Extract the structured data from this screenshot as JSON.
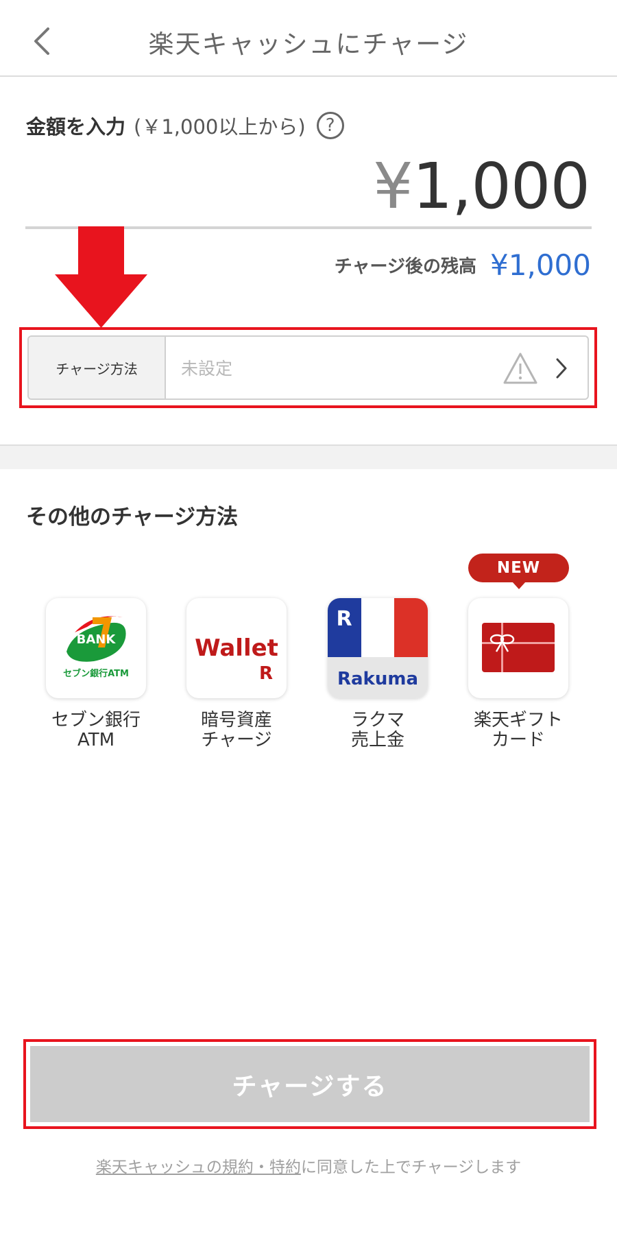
{
  "header": {
    "title": "楽天キャッシュにチャージ"
  },
  "amount": {
    "label": "金額を入力",
    "min_note": "(￥1,000以上から)",
    "help_symbol": "?",
    "currency_symbol": "¥",
    "value": "1,000"
  },
  "balance": {
    "label": "チャージ後の残高",
    "value": "¥1,000"
  },
  "method": {
    "label": "チャージ方法",
    "value": "未設定"
  },
  "other_methods": {
    "title": "その他のチャージ方法",
    "new_badge": "NEW",
    "items": [
      {
        "label": "セブン銀行\nATM",
        "icon": "seven-bank-icon",
        "icon_text_top": "BANK",
        "icon_text_bottom": "セブン銀行ATM"
      },
      {
        "label": "暗号資産\nチャージ",
        "icon": "rakuten-wallet-icon",
        "icon_text_top": "Wallet",
        "icon_text_bottom": "R"
      },
      {
        "label": "ラクマ\n売上金",
        "icon": "rakuma-icon",
        "icon_text_top": "R",
        "icon_text_bottom": "Rakuma"
      },
      {
        "label": "楽天ギフト\nカード",
        "icon": "gift-card-icon"
      }
    ]
  },
  "submit": {
    "label": "チャージする"
  },
  "terms": {
    "link": "楽天キャッシュの規約・特約",
    "rest": "に同意した上でチャージします"
  },
  "colors": {
    "annotation_red": "#e8141e",
    "balance_blue": "#2f6ed1",
    "badge_red": "#c2231b",
    "button_disabled": "#cccccc"
  }
}
